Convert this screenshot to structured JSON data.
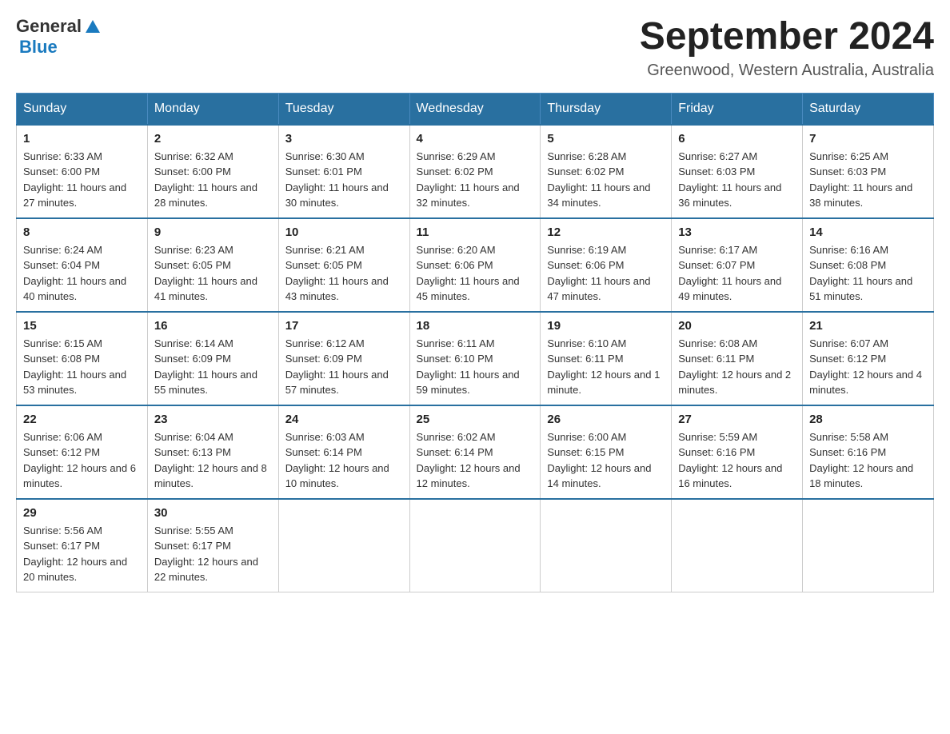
{
  "header": {
    "logo": {
      "text_general": "General",
      "text_blue": "Blue",
      "alt": "GeneralBlue logo"
    },
    "title": "September 2024",
    "location": "Greenwood, Western Australia, Australia"
  },
  "calendar": {
    "days_of_week": [
      "Sunday",
      "Monday",
      "Tuesday",
      "Wednesday",
      "Thursday",
      "Friday",
      "Saturday"
    ],
    "weeks": [
      [
        {
          "date": "1",
          "sunrise": "Sunrise: 6:33 AM",
          "sunset": "Sunset: 6:00 PM",
          "daylight": "Daylight: 11 hours and 27 minutes."
        },
        {
          "date": "2",
          "sunrise": "Sunrise: 6:32 AM",
          "sunset": "Sunset: 6:00 PM",
          "daylight": "Daylight: 11 hours and 28 minutes."
        },
        {
          "date": "3",
          "sunrise": "Sunrise: 6:30 AM",
          "sunset": "Sunset: 6:01 PM",
          "daylight": "Daylight: 11 hours and 30 minutes."
        },
        {
          "date": "4",
          "sunrise": "Sunrise: 6:29 AM",
          "sunset": "Sunset: 6:02 PM",
          "daylight": "Daylight: 11 hours and 32 minutes."
        },
        {
          "date": "5",
          "sunrise": "Sunrise: 6:28 AM",
          "sunset": "Sunset: 6:02 PM",
          "daylight": "Daylight: 11 hours and 34 minutes."
        },
        {
          "date": "6",
          "sunrise": "Sunrise: 6:27 AM",
          "sunset": "Sunset: 6:03 PM",
          "daylight": "Daylight: 11 hours and 36 minutes."
        },
        {
          "date": "7",
          "sunrise": "Sunrise: 6:25 AM",
          "sunset": "Sunset: 6:03 PM",
          "daylight": "Daylight: 11 hours and 38 minutes."
        }
      ],
      [
        {
          "date": "8",
          "sunrise": "Sunrise: 6:24 AM",
          "sunset": "Sunset: 6:04 PM",
          "daylight": "Daylight: 11 hours and 40 minutes."
        },
        {
          "date": "9",
          "sunrise": "Sunrise: 6:23 AM",
          "sunset": "Sunset: 6:05 PM",
          "daylight": "Daylight: 11 hours and 41 minutes."
        },
        {
          "date": "10",
          "sunrise": "Sunrise: 6:21 AM",
          "sunset": "Sunset: 6:05 PM",
          "daylight": "Daylight: 11 hours and 43 minutes."
        },
        {
          "date": "11",
          "sunrise": "Sunrise: 6:20 AM",
          "sunset": "Sunset: 6:06 PM",
          "daylight": "Daylight: 11 hours and 45 minutes."
        },
        {
          "date": "12",
          "sunrise": "Sunrise: 6:19 AM",
          "sunset": "Sunset: 6:06 PM",
          "daylight": "Daylight: 11 hours and 47 minutes."
        },
        {
          "date": "13",
          "sunrise": "Sunrise: 6:17 AM",
          "sunset": "Sunset: 6:07 PM",
          "daylight": "Daylight: 11 hours and 49 minutes."
        },
        {
          "date": "14",
          "sunrise": "Sunrise: 6:16 AM",
          "sunset": "Sunset: 6:08 PM",
          "daylight": "Daylight: 11 hours and 51 minutes."
        }
      ],
      [
        {
          "date": "15",
          "sunrise": "Sunrise: 6:15 AM",
          "sunset": "Sunset: 6:08 PM",
          "daylight": "Daylight: 11 hours and 53 minutes."
        },
        {
          "date": "16",
          "sunrise": "Sunrise: 6:14 AM",
          "sunset": "Sunset: 6:09 PM",
          "daylight": "Daylight: 11 hours and 55 minutes."
        },
        {
          "date": "17",
          "sunrise": "Sunrise: 6:12 AM",
          "sunset": "Sunset: 6:09 PM",
          "daylight": "Daylight: 11 hours and 57 minutes."
        },
        {
          "date": "18",
          "sunrise": "Sunrise: 6:11 AM",
          "sunset": "Sunset: 6:10 PM",
          "daylight": "Daylight: 11 hours and 59 minutes."
        },
        {
          "date": "19",
          "sunrise": "Sunrise: 6:10 AM",
          "sunset": "Sunset: 6:11 PM",
          "daylight": "Daylight: 12 hours and 1 minute."
        },
        {
          "date": "20",
          "sunrise": "Sunrise: 6:08 AM",
          "sunset": "Sunset: 6:11 PM",
          "daylight": "Daylight: 12 hours and 2 minutes."
        },
        {
          "date": "21",
          "sunrise": "Sunrise: 6:07 AM",
          "sunset": "Sunset: 6:12 PM",
          "daylight": "Daylight: 12 hours and 4 minutes."
        }
      ],
      [
        {
          "date": "22",
          "sunrise": "Sunrise: 6:06 AM",
          "sunset": "Sunset: 6:12 PM",
          "daylight": "Daylight: 12 hours and 6 minutes."
        },
        {
          "date": "23",
          "sunrise": "Sunrise: 6:04 AM",
          "sunset": "Sunset: 6:13 PM",
          "daylight": "Daylight: 12 hours and 8 minutes."
        },
        {
          "date": "24",
          "sunrise": "Sunrise: 6:03 AM",
          "sunset": "Sunset: 6:14 PM",
          "daylight": "Daylight: 12 hours and 10 minutes."
        },
        {
          "date": "25",
          "sunrise": "Sunrise: 6:02 AM",
          "sunset": "Sunset: 6:14 PM",
          "daylight": "Daylight: 12 hours and 12 minutes."
        },
        {
          "date": "26",
          "sunrise": "Sunrise: 6:00 AM",
          "sunset": "Sunset: 6:15 PM",
          "daylight": "Daylight: 12 hours and 14 minutes."
        },
        {
          "date": "27",
          "sunrise": "Sunrise: 5:59 AM",
          "sunset": "Sunset: 6:16 PM",
          "daylight": "Daylight: 12 hours and 16 minutes."
        },
        {
          "date": "28",
          "sunrise": "Sunrise: 5:58 AM",
          "sunset": "Sunset: 6:16 PM",
          "daylight": "Daylight: 12 hours and 18 minutes."
        }
      ],
      [
        {
          "date": "29",
          "sunrise": "Sunrise: 5:56 AM",
          "sunset": "Sunset: 6:17 PM",
          "daylight": "Daylight: 12 hours and 20 minutes."
        },
        {
          "date": "30",
          "sunrise": "Sunrise: 5:55 AM",
          "sunset": "Sunset: 6:17 PM",
          "daylight": "Daylight: 12 hours and 22 minutes."
        },
        null,
        null,
        null,
        null,
        null
      ]
    ]
  }
}
